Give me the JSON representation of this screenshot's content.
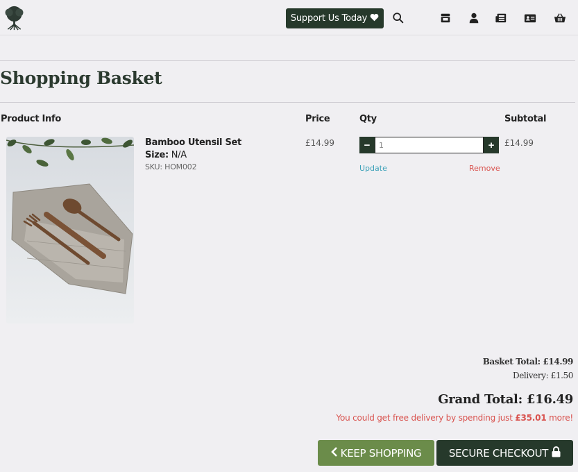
{
  "header": {
    "support_label": "Support Us Today",
    "icons": [
      "tree-logo",
      "heart-icon",
      "search-icon",
      "store-icon",
      "user-icon",
      "newspaper-icon",
      "contact-card-icon",
      "basket-icon"
    ]
  },
  "page": {
    "title": "Shopping Basket"
  },
  "table": {
    "headers": {
      "product": "Product Info",
      "price": "Price",
      "qty": "Qty",
      "subtotal": "Subtotal"
    }
  },
  "item": {
    "name": "Bamboo Utensil Set",
    "size_label": "Size:",
    "size_value": "N/A",
    "sku": "SKU: HOM002",
    "price": "£14.99",
    "qty": "1",
    "minus": "−",
    "plus": "+",
    "update": "Update",
    "remove": "Remove",
    "subtotal": "£14.99"
  },
  "totals": {
    "basket_total": "Basket Total: £14.99",
    "delivery": "Delivery: £1.50",
    "grand_total": "Grand Total: £16.49",
    "free_delivery_prefix": "You could get free delivery by spending just",
    "free_delivery_amount": "£35.01",
    "free_delivery_suffix": "more!"
  },
  "actions": {
    "keep_shopping": "KEEP SHOPPING",
    "secure_checkout": "SECURE CHECKOUT"
  },
  "colors": {
    "primary": "#26392b",
    "secondary": "#6b8c4a",
    "danger": "#d9534f",
    "link": "#3aa0b8",
    "background": "#f0eff2"
  }
}
